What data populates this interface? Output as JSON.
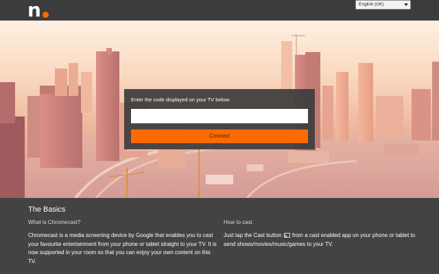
{
  "header": {
    "logo_letter": "n",
    "language_select": {
      "selected": "English (UK)"
    }
  },
  "connect_panel": {
    "label": "Enter the code displayed on your TV below:",
    "code_input": {
      "value": "",
      "placeholder": ""
    },
    "connect_label": "Connect"
  },
  "basics": {
    "title": "The Basics",
    "left": {
      "heading": "What is Chromecast?",
      "text": "Chromecast is a media screening device by Google that enables you to cast your favourite entertainment from your phone or tablet straight to your TV. It is now supported in your room so that you can enjoy your own content on this TV."
    },
    "right": {
      "heading": "How to cast",
      "text_before_icon": "Just tap the Cast button",
      "text_after_icon": "from a cast enabled app on your phone or tablet to send shows/movies/music/games to your TV."
    }
  },
  "colors": {
    "accent": "#ff6a00",
    "header_bg": "#3c3c3c",
    "body_bg": "#434343"
  },
  "icons": {
    "logo_dot": "orange-dot",
    "cast": "cast-icon",
    "select_caret": "chevron-down-icon"
  }
}
